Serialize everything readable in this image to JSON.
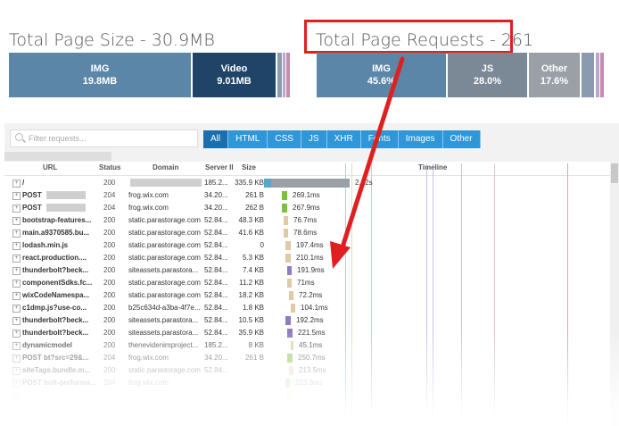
{
  "page_size": {
    "title": "Total Page Size - 30.9MB",
    "segments": [
      {
        "name": "IMG",
        "value": "19.8MB",
        "color": "#5b86a8"
      },
      {
        "name": "Video",
        "value": "9.01MB",
        "color": "#1f4467"
      }
    ]
  },
  "page_requests": {
    "title": "Total Page Requests - 261",
    "segments": [
      {
        "name": "IMG",
        "value": "45.6%",
        "color": "#5b86a8"
      },
      {
        "name": "JS",
        "value": "28.0%",
        "color": "#7b8896"
      },
      {
        "name": "Other",
        "value": "17.6%",
        "color": "#9aa0a6"
      }
    ]
  },
  "filter": {
    "placeholder": "Filter requests...",
    "tabs": [
      "All",
      "HTML",
      "CSS",
      "JS",
      "XHR",
      "Fonts",
      "Images",
      "Other"
    ],
    "active_tab": "All"
  },
  "table": {
    "headers": {
      "url": "URL",
      "status": "Status",
      "domain": "Domain",
      "server": "Server II",
      "size": "Size",
      "timeline": "Timeline"
    },
    "rows": [
      {
        "url": "/",
        "status": "200",
        "domain": "",
        "ip": "185.2...",
        "size": "335.9 KB",
        "timing": "2.62s",
        "color": "#9aa0a6"
      },
      {
        "url": "POST",
        "status": "204",
        "domain": "frog.wix.com",
        "ip": "34.20...",
        "size": "261 B",
        "timing": "269.1ms",
        "color": "#7ac143"
      },
      {
        "url": "POST",
        "status": "204",
        "domain": "frog.wix.com",
        "ip": "34.20...",
        "size": "262 B",
        "timing": "267.9ms",
        "color": "#7ac143"
      },
      {
        "url": "bootstrap-features...",
        "status": "200",
        "domain": "static.parastorage.com",
        "ip": "52.84...",
        "size": "48.3 KB",
        "timing": "76.7ms",
        "color": "#e0c9a6"
      },
      {
        "url": "main.a9370585.bu...",
        "status": "200",
        "domain": "static.parastorage.com",
        "ip": "52.84...",
        "size": "41.6 KB",
        "timing": "78.6ms",
        "color": "#e0c9a6"
      },
      {
        "url": "lodash.min.js",
        "status": "200",
        "domain": "static.parastorage.com",
        "ip": "52.84...",
        "size": "0",
        "timing": "197.4ms",
        "color": "#e0c9a6"
      },
      {
        "url": "react.production....",
        "status": "200",
        "domain": "static.parastorage.com",
        "ip": "52.84...",
        "size": "5.3 KB",
        "timing": "210.1ms",
        "color": "#e0c9a6"
      },
      {
        "url": "thunderbolt?beck...",
        "status": "200",
        "domain": "siteassets.parastora...",
        "ip": "52.84...",
        "size": "7.4 KB",
        "timing": "191.9ms",
        "color": "#8e7cc3"
      },
      {
        "url": "componentSdks.fc...",
        "status": "200",
        "domain": "static.parastorage.com",
        "ip": "52.84...",
        "size": "11.2 KB",
        "timing": "71ms",
        "color": "#e0c9a6"
      },
      {
        "url": "wixCodeNamespa...",
        "status": "200",
        "domain": "static.parastorage.com",
        "ip": "52.84...",
        "size": "18.2 KB",
        "timing": "72.2ms",
        "color": "#e0c9a6"
      },
      {
        "url": "c1dmp.js?use-co...",
        "status": "200",
        "domain": "b25c634d-a3ba-4f7e...",
        "ip": "52.84...",
        "size": "1.8 KB",
        "timing": "104.1ms",
        "color": "#e0c9a6"
      },
      {
        "url": "thunderbolt?beck...",
        "status": "200",
        "domain": "siteassets.parastora...",
        "ip": "52.84...",
        "size": "10.5 KB",
        "timing": "192.2ms",
        "color": "#8e7cc3"
      },
      {
        "url": "thunderbolt?beck...",
        "status": "200",
        "domain": "siteassets.parastora...",
        "ip": "52.84...",
        "size": "35.9 KB",
        "timing": "221.5ms",
        "color": "#8e7cc3"
      },
      {
        "url": "dynamicmodel",
        "status": "200",
        "domain": "thenevidenimproject...",
        "ip": "185.2...",
        "size": "8 KB",
        "timing": "45.1ms",
        "color": "#e0c9a6"
      },
      {
        "url": "POST bt?src=29&...",
        "status": "204",
        "domain": "frog.wix.com",
        "ip": "34.20...",
        "size": "261 B",
        "timing": "250.7ms",
        "color": "#7ac143"
      },
      {
        "url": "siteTags.bundle.m...",
        "status": "200",
        "domain": "static.parastorage.com",
        "ip": "52.84...",
        "size": "",
        "timing": "213.5ms",
        "color": "#e0c9a6"
      },
      {
        "url": "POST bolt-performa...",
        "status": "204",
        "domain": "frog.wix.com",
        "ip": "",
        "size": "",
        "timing": "223.3ms",
        "color": "#7ac143"
      },
      {
        "url": "",
        "status": "",
        "domain": "",
        "ip": "",
        "size": "",
        "timing": "",
        "color": "#e0c9a6"
      },
      {
        "url": "",
        "status": "",
        "domain": "",
        "ip": "",
        "size": "",
        "timing": "",
        "color": "#e0c9a6"
      }
    ]
  },
  "colors": {
    "highlight": "#e02020",
    "tab_blue": "#2f96d8",
    "tab_active": "#1b6fae"
  }
}
